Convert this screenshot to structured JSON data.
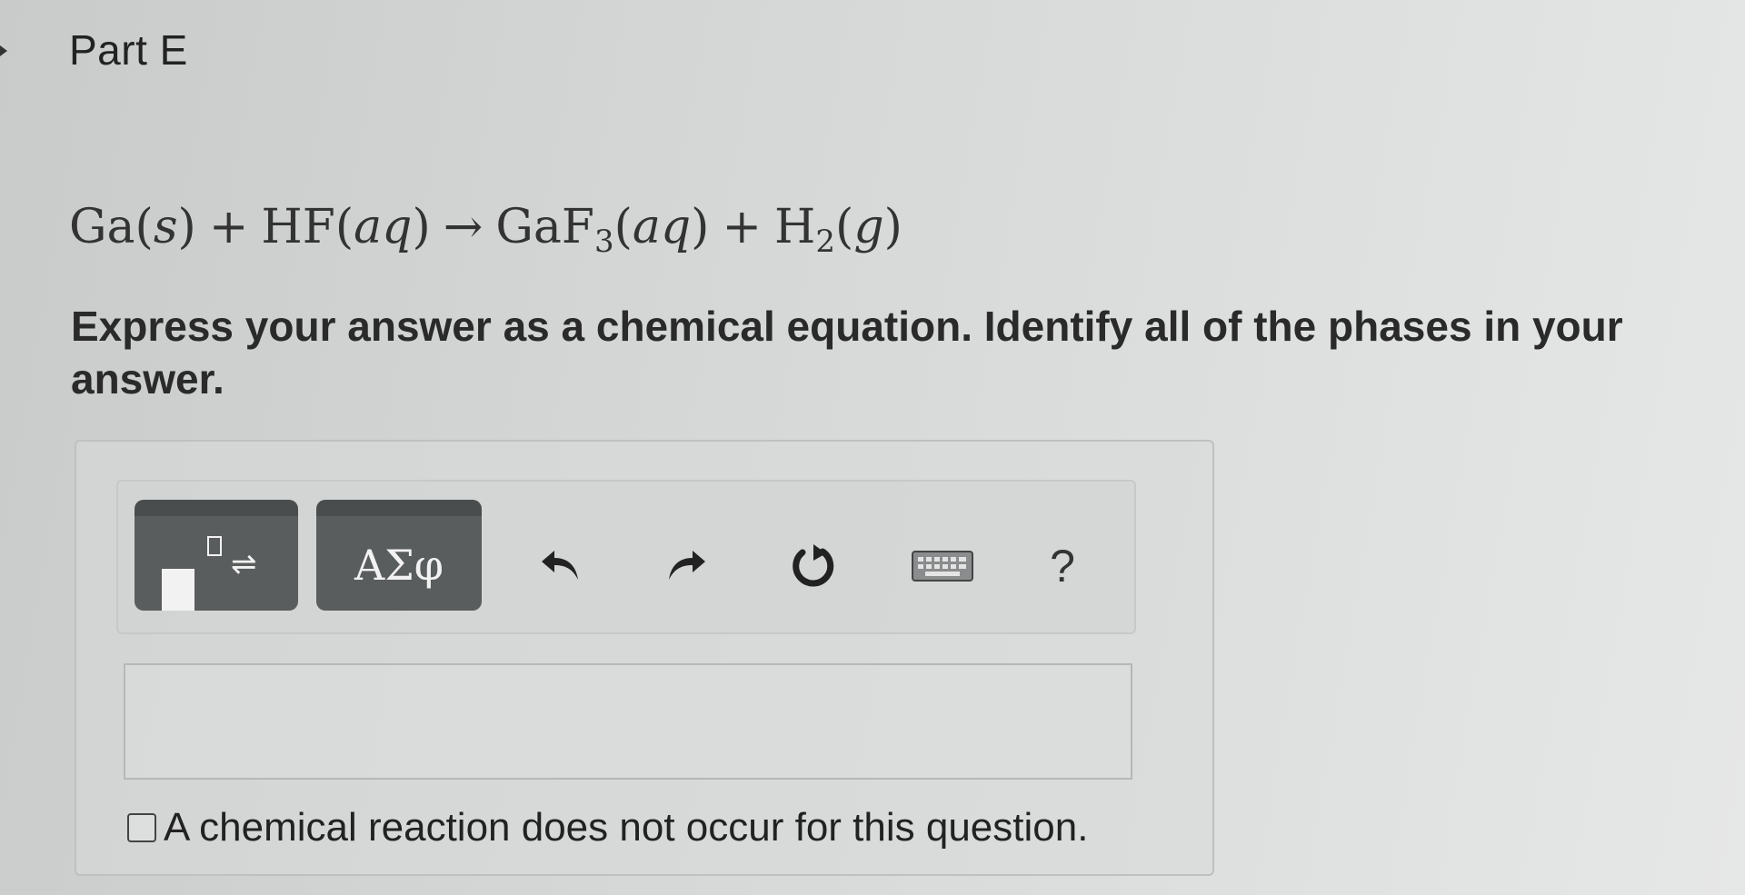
{
  "part": {
    "title": "Part E"
  },
  "equation": {
    "reactant1": "Ga",
    "reactant1_phase": "s",
    "reactant2": "HF",
    "reactant2_phase": "aq",
    "product1": "GaF",
    "product1_sub": "3",
    "product1_phase": "aq",
    "product2": "H",
    "product2_sub": "2",
    "product2_phase": "g",
    "plus": "+",
    "arrow": "→"
  },
  "instructions": "Express your answer as a chemical equation. Identify all of the phases in your answer.",
  "toolbar": {
    "templates_icon": "templates-icon",
    "templates_arrows": "⇌",
    "symbols_label": "ΑΣφ",
    "undo_icon": "undo-icon",
    "redo_icon": "redo-icon",
    "reset_icon": "reset-icon",
    "keyboard_icon": "keyboard-icon",
    "help_label": "?"
  },
  "answer": {
    "value": "",
    "placeholder": ""
  },
  "no_reaction": {
    "label": "A chemical reaction does not occur for this question.",
    "checked": false
  }
}
